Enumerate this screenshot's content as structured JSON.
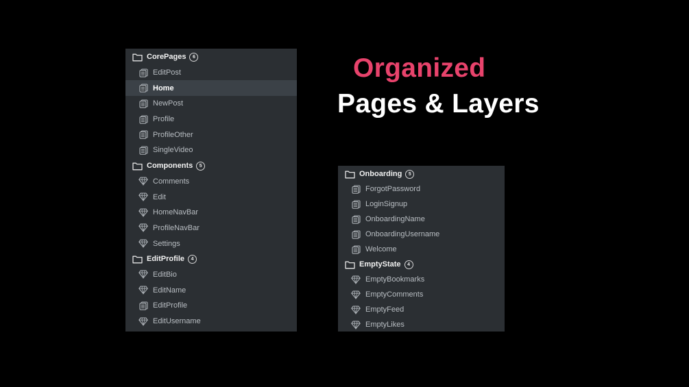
{
  "headline": {
    "accent": "Organized",
    "main": "Pages & Layers",
    "accent_color": "#e8436c"
  },
  "left_panel": {
    "groups": [
      {
        "name": "CorePages",
        "count": "6",
        "icon": "folder-icon",
        "items": [
          {
            "label": "EditPost",
            "icon": "page-icon"
          },
          {
            "label": "Home",
            "icon": "page-icon",
            "selected": true
          },
          {
            "label": "NewPost",
            "icon": "page-icon"
          },
          {
            "label": "Profile",
            "icon": "page-icon"
          },
          {
            "label": "ProfileOther",
            "icon": "page-icon"
          },
          {
            "label": "SingleVideo",
            "icon": "page-icon"
          }
        ]
      },
      {
        "name": "Components",
        "count": "5",
        "icon": "folder-icon",
        "items": [
          {
            "label": "Comments",
            "icon": "component-icon"
          },
          {
            "label": "Edit",
            "icon": "component-icon"
          },
          {
            "label": "HomeNavBar",
            "icon": "component-icon"
          },
          {
            "label": "ProfileNavBar",
            "icon": "component-icon"
          },
          {
            "label": "Settings",
            "icon": "component-icon"
          }
        ]
      },
      {
        "name": "EditProfile",
        "count": "4",
        "icon": "folder-icon",
        "items": [
          {
            "label": "EditBio",
            "icon": "component-icon"
          },
          {
            "label": "EditName",
            "icon": "component-icon"
          },
          {
            "label": "EditProfile",
            "icon": "page-icon"
          },
          {
            "label": "EditUsername",
            "icon": "component-icon"
          }
        ]
      }
    ]
  },
  "right_panel": {
    "groups": [
      {
        "name": "Onboarding",
        "count": "5",
        "icon": "folder-icon",
        "items": [
          {
            "label": "ForgotPassword",
            "icon": "page-icon"
          },
          {
            "label": "LoginSignup",
            "icon": "page-icon"
          },
          {
            "label": "OnboardingName",
            "icon": "page-icon"
          },
          {
            "label": "OnboardingUsername",
            "icon": "page-icon"
          },
          {
            "label": "Welcome",
            "icon": "page-icon"
          }
        ]
      },
      {
        "name": "EmptyState",
        "count": "4",
        "icon": "folder-icon",
        "items": [
          {
            "label": "EmptyBookmarks",
            "icon": "component-icon"
          },
          {
            "label": "EmptyComments",
            "icon": "component-icon"
          },
          {
            "label": "EmptyFeed",
            "icon": "component-icon"
          },
          {
            "label": "EmptyLikes",
            "icon": "component-icon"
          }
        ]
      }
    ]
  }
}
